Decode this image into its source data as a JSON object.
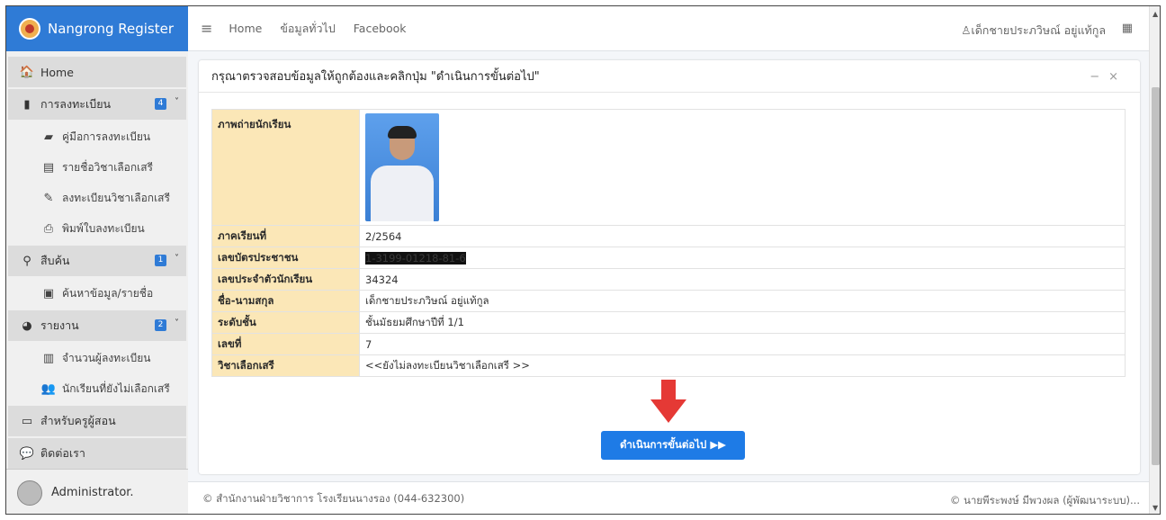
{
  "brand": {
    "title": "Nangrong Register"
  },
  "topbar": {
    "home": "Home",
    "general": "ข้อมูลทั่วไป",
    "facebook": "Facebook",
    "user": "เด็กชายประภวิษณ์ อยู่แท้กูล"
  },
  "sidebar": {
    "home": "Home",
    "register": {
      "label": "การลงทะเบียน",
      "badge": "4",
      "items": [
        "คู่มือการลงทะเบียน",
        "รายชื่อวิชาเลือกเสรี",
        "ลงทะเบียนวิชาเลือกเสรี",
        "พิมพ์ใบลงทะเบียน"
      ]
    },
    "search": {
      "label": "สืบค้น",
      "badge": "1",
      "items": [
        "ค้นหาข้อมูล/รายชื่อ"
      ]
    },
    "report": {
      "label": "รายงาน",
      "badge": "2",
      "items": [
        "จำนวนผู้ลงทะเบียน",
        "นักเรียนที่ยังไม่เลือกเสรี"
      ]
    },
    "teacher": "สำหรับครูผู้สอน",
    "contact": "ติดต่อเรา",
    "admin": "Administrator."
  },
  "card": {
    "title": "กรุณาตรวจสอบข้อมูลให้ถูกต้องและคลิกปุ่ม \"ดำเนินการขั้นต่อไป\"",
    "rows": [
      {
        "label": "ภาพถ่ายนักเรียน",
        "value": ""
      },
      {
        "label": "ภาคเรียนที่",
        "value": "2/2564"
      },
      {
        "label": "เลขบัตรประชาชน",
        "value": "1-3199-01218-81-6"
      },
      {
        "label": "เลขประจำตัวนักเรียน",
        "value": "34324"
      },
      {
        "label": "ชื่อ-นามสกุล",
        "value": "เด็กชายประภวิษณ์ อยู่แท้กูล"
      },
      {
        "label": "ระดับชั้น",
        "value": "ชั้นมัธยมศึกษาปีที่ 1/1"
      },
      {
        "label": "เลขที่",
        "value": "7"
      },
      {
        "label": "วิชาเลือกเสรี",
        "value": "<<ยังไม่ลงทะเบียนวิชาเลือกเสรี >>"
      }
    ],
    "next_button": "ดำเนินการขั้นต่อไป ▶▶"
  },
  "footer": {
    "left": "© สำนักงานฝ่ายวิชาการ โรงเรียนนางรอง (044-632300)",
    "right": "© นายพีระพงษ์ มีพวงผล (ผู้พัฒนาระบบ)..."
  }
}
